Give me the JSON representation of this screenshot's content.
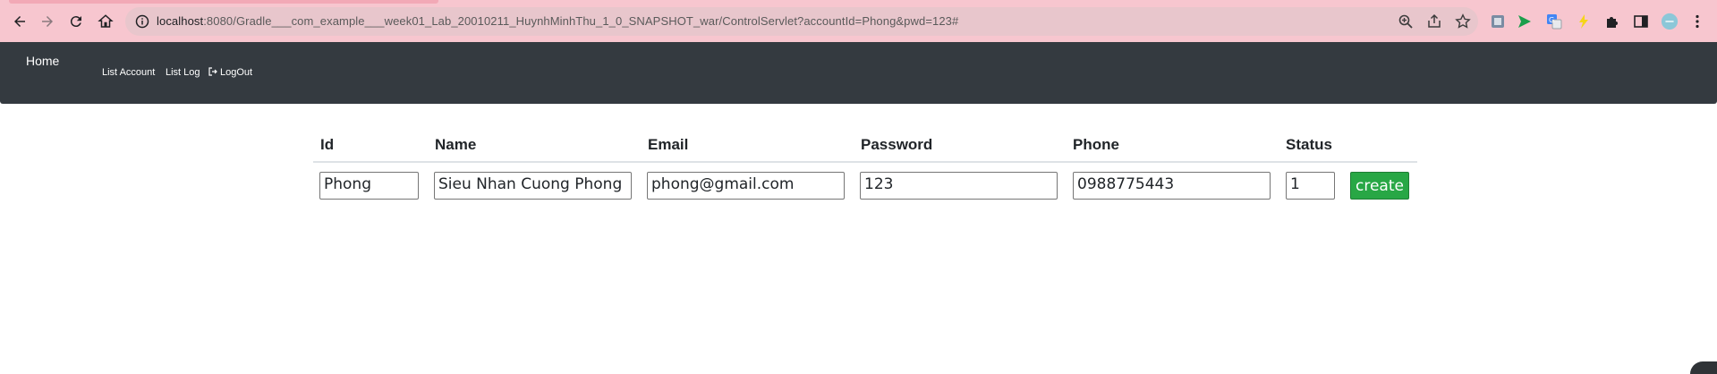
{
  "browser": {
    "url_host": "localhost",
    "url_rest": ":8080/Gradle___com_example___week01_Lab_20010211_HuynhMinhThu_1_0_SNAPSHOT_war/ControlServlet?accountId=Phong&pwd=123#",
    "accent_color": "#f7c6cf",
    "icons": [
      "back-icon",
      "forward-icon",
      "reload-icon",
      "home-icon",
      "site-info-icon",
      "zoom-icon",
      "share-icon",
      "star-icon",
      "extensions"
    ]
  },
  "navbar": {
    "brand": "Home",
    "links": [
      "List Account",
      "List Log",
      "LogOut"
    ],
    "background": "#343a40"
  },
  "table": {
    "columns": [
      "Id",
      "Name",
      "Email",
      "Password",
      "Phone",
      "Status"
    ],
    "row": {
      "id": "Phong",
      "name": "Sieu Nhan Cuong Phong",
      "email": "phong@gmail.com",
      "password": "123",
      "phone": "0988775443",
      "status": "1"
    },
    "create_label": "create",
    "create_color": "#28a745"
  }
}
